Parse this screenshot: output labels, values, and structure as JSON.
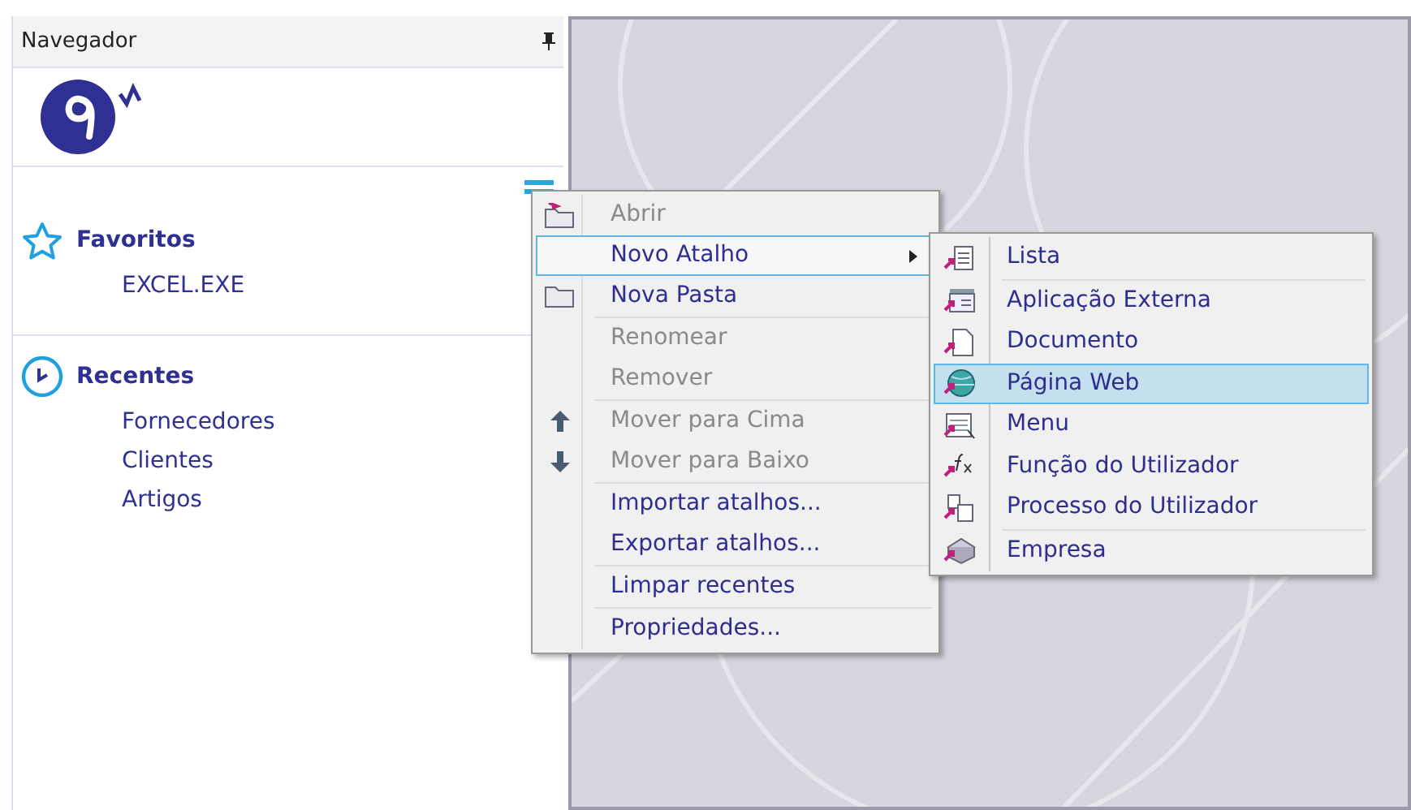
{
  "navigator": {
    "title": "Navegador",
    "sections": [
      {
        "kind": "favorites",
        "title": "Favoritos",
        "items": [
          "EXCEL.EXE"
        ]
      },
      {
        "kind": "recent",
        "title": "Recentes",
        "items": [
          "Fornecedores",
          "Clientes",
          "Artigos"
        ]
      }
    ]
  },
  "context_menu": {
    "items": [
      {
        "kind": "item",
        "label": "Abrir",
        "disabled": true,
        "selected": false,
        "submenu": false
      },
      {
        "kind": "item",
        "label": "Novo Atalho",
        "disabled": false,
        "selected": true,
        "submenu": true
      },
      {
        "kind": "item",
        "label": "Nova Pasta",
        "disabled": false,
        "selected": false,
        "submenu": false
      },
      {
        "kind": "separator"
      },
      {
        "kind": "item",
        "label": "Renomear",
        "disabled": true,
        "selected": false,
        "submenu": false
      },
      {
        "kind": "item",
        "label": "Remover",
        "disabled": true,
        "selected": false,
        "submenu": false
      },
      {
        "kind": "separator"
      },
      {
        "kind": "item",
        "label": "Mover para Cima",
        "disabled": true,
        "selected": false,
        "submenu": false
      },
      {
        "kind": "item",
        "label": "Mover para Baixo",
        "disabled": true,
        "selected": false,
        "submenu": false
      },
      {
        "kind": "separator"
      },
      {
        "kind": "item",
        "label": "Importar atalhos...",
        "disabled": false,
        "selected": false,
        "submenu": false
      },
      {
        "kind": "item",
        "label": "Exportar atalhos...",
        "disabled": false,
        "selected": false,
        "submenu": false
      },
      {
        "kind": "separator"
      },
      {
        "kind": "item",
        "label": "Limpar recentes",
        "disabled": false,
        "selected": false,
        "submenu": false
      },
      {
        "kind": "separator"
      },
      {
        "kind": "item",
        "label": "Propriedades...",
        "disabled": false,
        "selected": false,
        "submenu": false
      }
    ]
  },
  "submenu": {
    "items": [
      {
        "kind": "item",
        "label": "Lista",
        "selected": false
      },
      {
        "kind": "separator"
      },
      {
        "kind": "item",
        "label": "Aplicação Externa",
        "selected": false
      },
      {
        "kind": "item",
        "label": "Documento",
        "selected": false
      },
      {
        "kind": "item",
        "label": "Página Web",
        "selected": true
      },
      {
        "kind": "item",
        "label": "Menu",
        "selected": false
      },
      {
        "kind": "item",
        "label": "Função do Utilizador",
        "selected": false
      },
      {
        "kind": "item",
        "label": "Processo do Utilizador",
        "selected": false
      },
      {
        "kind": "separator"
      },
      {
        "kind": "item",
        "label": "Empresa",
        "selected": false
      }
    ]
  }
}
